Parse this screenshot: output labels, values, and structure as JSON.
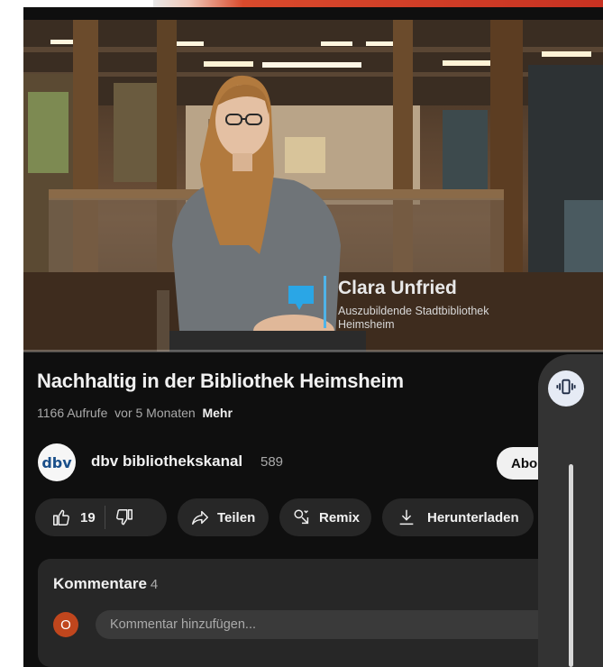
{
  "video": {
    "lower_third_name": "Clara Unfried",
    "lower_third_subtitle": "Auszubildende Stadtbibliothek Heimsheim",
    "progress_fraction": 0.0
  },
  "title": "Nachhaltig in der Bibliothek Heimsheim",
  "meta": {
    "views": "1166 Aufrufe",
    "age": "vor 5 Monaten",
    "more": "Mehr"
  },
  "channel": {
    "logo_text": "dbv",
    "name": "dbv bibliothekskanal",
    "count": "589",
    "subscribe": "Abo"
  },
  "actions": {
    "likes": "19",
    "share": "Teilen",
    "remix": "Remix",
    "download": "Herunterladen"
  },
  "comments": {
    "title": "Kommentare",
    "count": "4",
    "avatar_letter": "O",
    "placeholder": "Kommentar hinzufügen..."
  },
  "icons": {
    "like": "thumb-up-icon",
    "dislike": "thumb-down-icon",
    "share": "share-arrow-icon",
    "remix": "remix-icon",
    "download": "download-icon",
    "vibrate": "vibrate-icon"
  },
  "colors": {
    "background": "#0f0f0f",
    "pill": "#272727",
    "accent_blue": "#4fb3e8",
    "avatar": "#c0461d",
    "top_bar_red": "#c83222"
  }
}
